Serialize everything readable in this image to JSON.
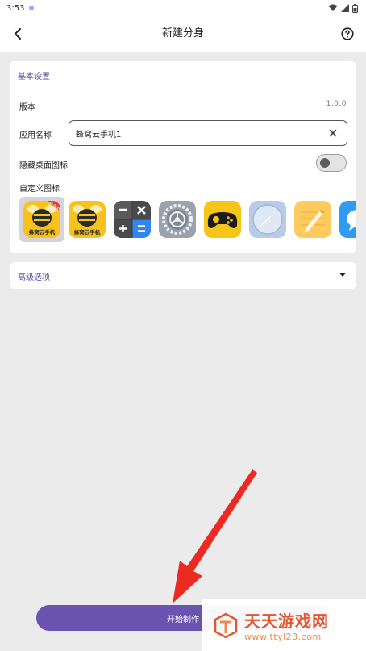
{
  "status_bar": {
    "time": "3:53"
  },
  "header": {
    "title": "新建分身"
  },
  "basic": {
    "section_title": "基本设置",
    "version_label": "版本",
    "version_value": "1.0.0",
    "app_name_label": "应用名称",
    "app_name_value": "蜂窝云手机1",
    "hide_icon_label": "隐藏桌面图标",
    "hide_icon_enabled": false,
    "custom_icon_label": "自定义图标",
    "icons": [
      {
        "name": "fengwo-cloud-phone-clone-icon",
        "caption": "蜂窝云手机",
        "badge": "分身版",
        "selected": true
      },
      {
        "name": "fengwo-cloud-phone-icon",
        "caption": "蜂窝云手机"
      },
      {
        "name": "calculator-icon"
      },
      {
        "name": "settings-gear-icon"
      },
      {
        "name": "gamepad-icon"
      },
      {
        "name": "compass-browser-icon"
      },
      {
        "name": "notes-pencil-icon"
      },
      {
        "name": "message-bubble-icon"
      }
    ]
  },
  "advanced": {
    "label": "高级选项"
  },
  "actions": {
    "start_label": "开始制作"
  },
  "watermark": {
    "cn": "天天游戏网",
    "url": "www.ttyl23.com"
  },
  "colors": {
    "accent": "#6b54b0",
    "section_title": "#5a4aa0",
    "background": "#ebebeb"
  }
}
